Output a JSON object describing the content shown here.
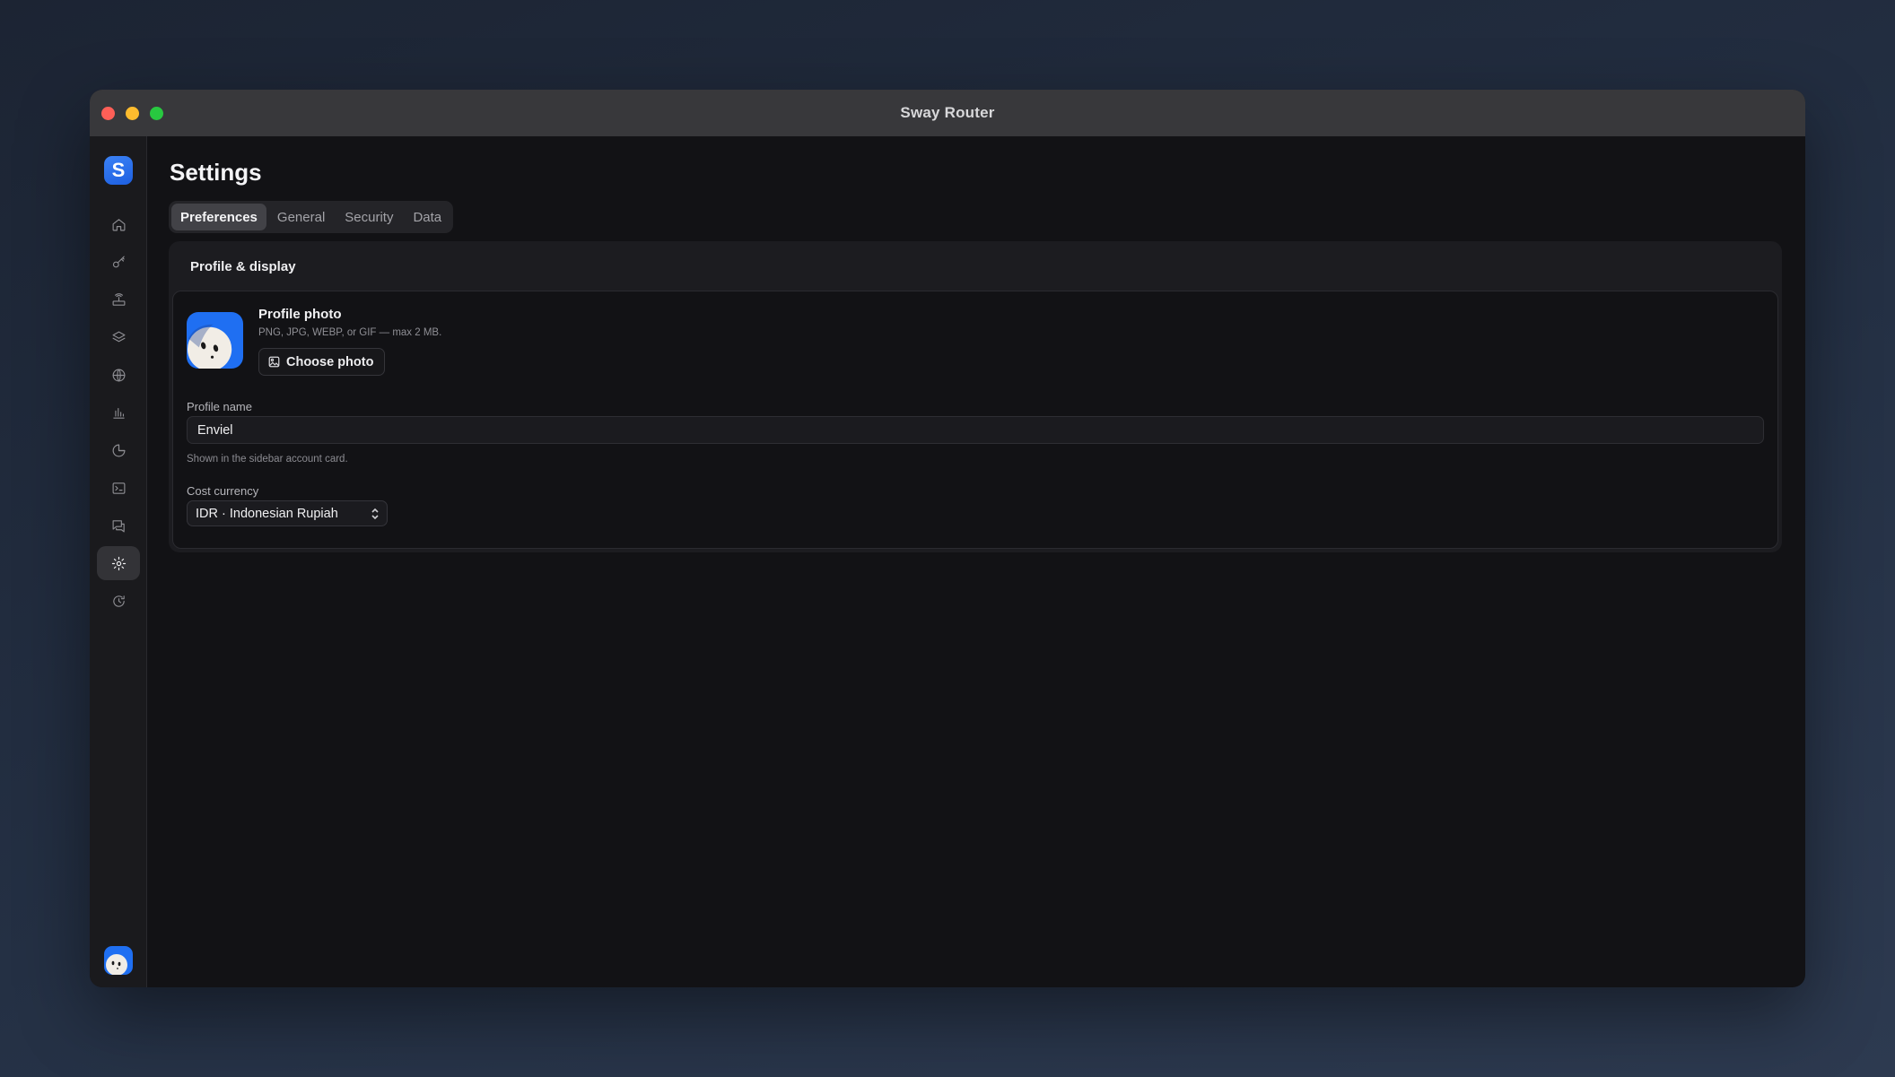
{
  "window": {
    "title": "Sway Router"
  },
  "sidebar": {
    "logo_letter": "S",
    "items": [
      {
        "icon": "home-icon",
        "active": false
      },
      {
        "icon": "key-icon",
        "active": false
      },
      {
        "icon": "router-icon",
        "active": false
      },
      {
        "icon": "layers-icon",
        "active": false
      },
      {
        "icon": "globe-icon",
        "active": false
      },
      {
        "icon": "bar-chart-icon",
        "active": false
      },
      {
        "icon": "pie-chart-icon",
        "active": false
      },
      {
        "icon": "terminal-icon",
        "active": false
      },
      {
        "icon": "messages-icon",
        "active": false
      },
      {
        "icon": "gear-icon",
        "active": true
      },
      {
        "icon": "refresh-clock-icon",
        "active": false
      }
    ]
  },
  "page": {
    "title": "Settings",
    "tabs": [
      {
        "label": "Preferences",
        "active": true
      },
      {
        "label": "General",
        "active": false
      },
      {
        "label": "Security",
        "active": false
      },
      {
        "label": "Data",
        "active": false
      }
    ]
  },
  "profile_card": {
    "heading": "Profile & display",
    "photo_label": "Profile photo",
    "photo_hint": "PNG, JPG, WEBP, or GIF — max 2 MB.",
    "choose_button": "Choose photo",
    "name_label": "Profile name",
    "name_value": "Enviel",
    "name_helper": "Shown in the sidebar account card.",
    "currency_label": "Cost currency",
    "currency_value": "IDR · Indonesian Rupiah"
  },
  "colors": {
    "accent": "#1f6ff2",
    "window_bg": "#121215",
    "titlebar": "#38383b"
  }
}
